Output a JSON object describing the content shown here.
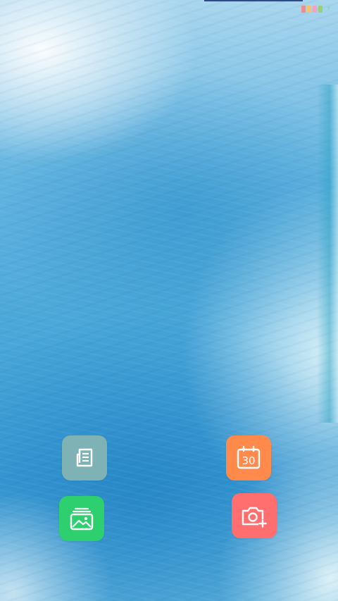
{
  "status_bar": {
    "indicator_colors": [
      "#f28b8b",
      "#f4c36a",
      "#f5a3c0",
      "#9ad07a"
    ],
    "battery_icon": "battery-icon"
  },
  "home_screen": {
    "wallpaper": "blue-watercolor",
    "apps": [
      {
        "name": "notes",
        "icon": "document-lines-icon",
        "color": "#7fb2b4"
      },
      {
        "name": "calendar",
        "icon": "calendar-icon",
        "color": "#ff8a4c",
        "date_text": "30"
      },
      {
        "name": "gallery",
        "icon": "photo-stack-icon",
        "color": "#2dcf6e"
      },
      {
        "name": "camera",
        "icon": "camera-plus-icon",
        "color": "#ff6f6f"
      }
    ]
  }
}
